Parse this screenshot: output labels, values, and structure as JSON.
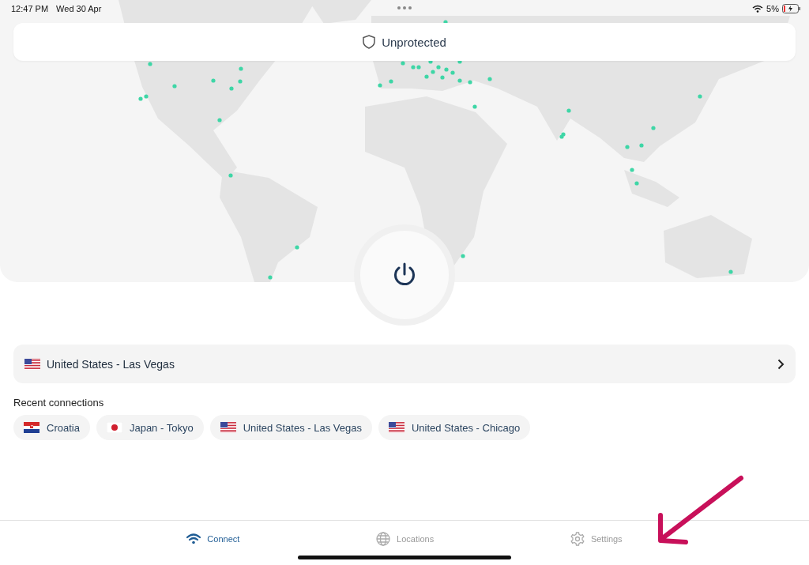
{
  "status_bar": {
    "time": "12:47 PM",
    "date": "Wed 30 Apr",
    "battery": "5%"
  },
  "protection": {
    "status": "Unprotected",
    "protected": false
  },
  "current_location": {
    "kind": "us",
    "label": "United States - Las Vegas"
  },
  "recent": {
    "title": "Recent connections",
    "items": [
      {
        "kind": "hr",
        "label": "Croatia"
      },
      {
        "kind": "jp",
        "label": "Japan - Tokyo"
      },
      {
        "kind": "us",
        "label": "United States - Las Vegas"
      },
      {
        "kind": "us",
        "label": "United States - Chicago"
      }
    ]
  },
  "tabs": [
    {
      "label": "Connect",
      "selected": true
    },
    {
      "label": "Locations",
      "selected": false
    },
    {
      "label": "Settings",
      "selected": false
    }
  ]
}
